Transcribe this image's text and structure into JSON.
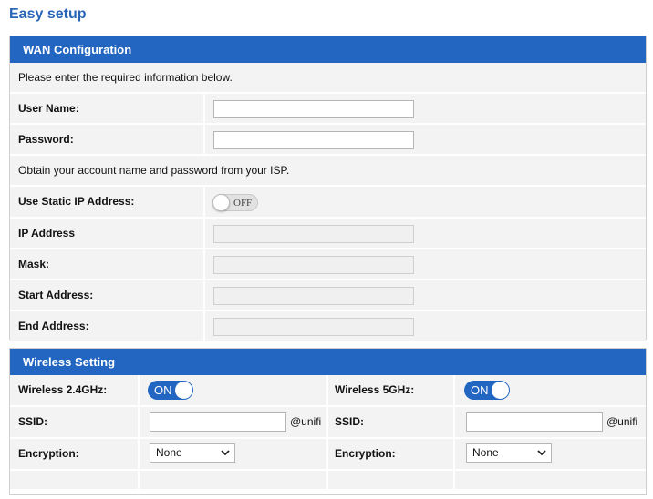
{
  "page": {
    "title": "Easy setup"
  },
  "wan": {
    "header": "WAN Configuration",
    "intro": "Please enter the required information below.",
    "username_label": "User Name:",
    "username_value": "",
    "password_label": "Password:",
    "password_value": "",
    "note": "Obtain your account name and password from your ISP.",
    "static_ip_label": "Use Static IP Address:",
    "static_ip_state": "OFF",
    "ip_label": "IP Address",
    "mask_label": "Mask:",
    "start_label": "Start Address:",
    "end_label": "End Address:"
  },
  "wireless": {
    "header": "Wireless Setting",
    "band24": {
      "label": "Wireless 2.4GHz:",
      "state": "ON",
      "ssid_label": "SSID:",
      "ssid_value": "",
      "ssid_suffix": "@unifi",
      "encryption_label": "Encryption:",
      "encryption_value": "None"
    },
    "band5": {
      "label": "Wireless 5GHz:",
      "state": "ON",
      "ssid_label": "SSID:",
      "ssid_value": "",
      "ssid_suffix": "@unifi",
      "encryption_label": "Encryption:",
      "encryption_value": "None"
    }
  },
  "colors": {
    "accent": "#2266c2",
    "title": "#2a66b8",
    "row_bg": "#f3f3f3"
  },
  "icons": {
    "select_arrow": "chevron-down-icon"
  }
}
